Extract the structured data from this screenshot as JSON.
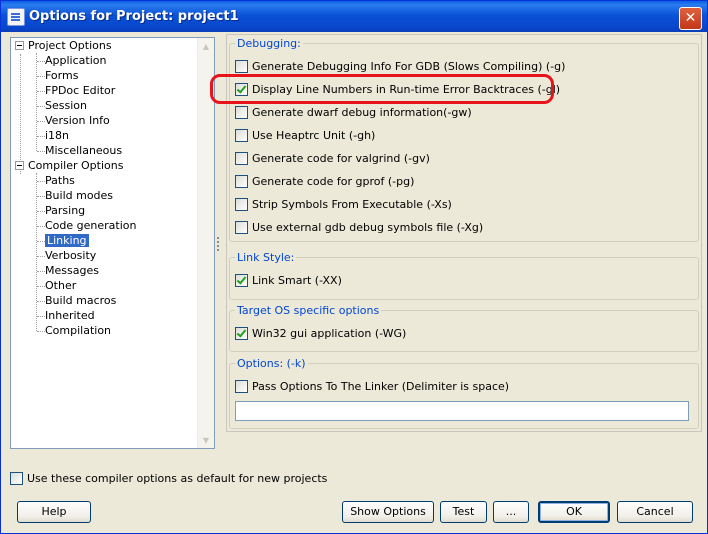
{
  "window": {
    "title": "Options for Project: project1"
  },
  "tree": {
    "root_project": "Project Options",
    "project_items": [
      "Application",
      "Forms",
      "FPDoc Editor",
      "Session",
      "Version Info",
      "i18n",
      "Miscellaneous"
    ],
    "root_compiler": "Compiler Options",
    "compiler_items": [
      "Paths",
      "Build modes",
      "Parsing",
      "Code generation",
      "Linking",
      "Verbosity",
      "Messages",
      "Other",
      "Build macros",
      "Inherited",
      "Compilation"
    ],
    "selected": "Linking"
  },
  "debugging": {
    "label": "Debugging:",
    "options": [
      {
        "label": "Generate Debugging Info For GDB (Slows Compiling) (-g)",
        "checked": false
      },
      {
        "label": "Display Line Numbers in Run-time Error Backtraces (-gl)",
        "checked": true
      },
      {
        "label": "Generate dwarf debug information(-gw)",
        "checked": false
      },
      {
        "label": "Use Heaptrc Unit (-gh)",
        "checked": false
      },
      {
        "label": "Generate code for valgrind (-gv)",
        "checked": false
      },
      {
        "label": "Generate code for gprof (-pg)",
        "checked": false
      },
      {
        "label": "Strip Symbols From Executable (-Xs)",
        "checked": false
      },
      {
        "label": "Use external gdb debug symbols file (-Xg)",
        "checked": false
      }
    ]
  },
  "link_style": {
    "label": "Link Style:",
    "option": "Link Smart (-XX)",
    "checked": true
  },
  "target_os": {
    "label": "Target OS specific options",
    "option": "Win32 gui application (-WG)",
    "checked": true
  },
  "options_k": {
    "label": "Options: (-k)",
    "option": "Pass Options To The Linker (Delimiter is space)",
    "checked": false,
    "value": ""
  },
  "default_checkbox": {
    "label": "Use these compiler options as default for new projects",
    "checked": false
  },
  "buttons": {
    "help": "Help",
    "show_options": "Show Options",
    "test": "Test",
    "ellipsis": "...",
    "ok": "OK",
    "cancel": "Cancel"
  }
}
